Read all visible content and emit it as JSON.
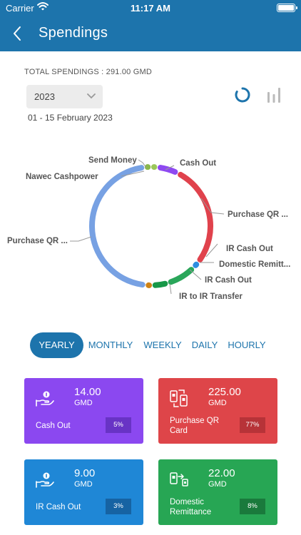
{
  "status_bar": {
    "carrier": "Carrier",
    "time": "11:17 AM"
  },
  "header": {
    "title": "Spendings"
  },
  "summary": {
    "total": "TOTAL SPENDINGS : 291.00 GMD",
    "year": "2023",
    "date_range": "01 - 15 February 2023"
  },
  "chart_data": {
    "type": "pie",
    "labels": [
      "Cash Out",
      "Purchase QR ...",
      "IR Cash Out",
      "Domestic Remitt...",
      "IR Cash Out",
      "IR to IR Transfer",
      "Purchase QR ...",
      "Nawec Cashpower",
      "Send Money"
    ],
    "values": [
      14,
      90,
      1,
      22,
      9,
      0.5,
      154,
      0.25,
      0.25
    ],
    "colors": [
      "#8e49f1",
      "#e0424c",
      "#2e8de0",
      "#2aa65a",
      "#179848",
      "#ce8216",
      "#77a1e3",
      "#8ab84b",
      "#9ac75a"
    ]
  },
  "period_tabs": [
    {
      "label": "YEARLY",
      "active": true
    },
    {
      "label": "MONTHLY",
      "active": false
    },
    {
      "label": "WEEKLY",
      "active": false
    },
    {
      "label": "DAILY",
      "active": false
    },
    {
      "label": "HOURLY",
      "active": false
    }
  ],
  "cards": [
    {
      "amount": "14.00",
      "currency": "GMD",
      "label": "Cash Out",
      "percent": "5%",
      "color": "#8b48f0",
      "badge_color": "#6833c5",
      "icon": "hand-coin-icon"
    },
    {
      "amount": "225.00",
      "currency": "GMD",
      "label": "Purchase QR Card",
      "percent": "77%",
      "color": "#de4549",
      "badge_color": "#b73338",
      "icon": "phone-transfer-icon"
    },
    {
      "amount": "9.00",
      "currency": "GMD",
      "label": "IR Cash Out",
      "percent": "3%",
      "color": "#1f87d6",
      "badge_color": "#1663a3",
      "icon": "hand-coin-icon"
    },
    {
      "amount": "22.00",
      "currency": "GMD",
      "label": "Domestic Remittance",
      "percent": "8%",
      "color": "#27a654",
      "badge_color": "#1a7a3c",
      "icon": "phone-transfer-icon"
    }
  ]
}
